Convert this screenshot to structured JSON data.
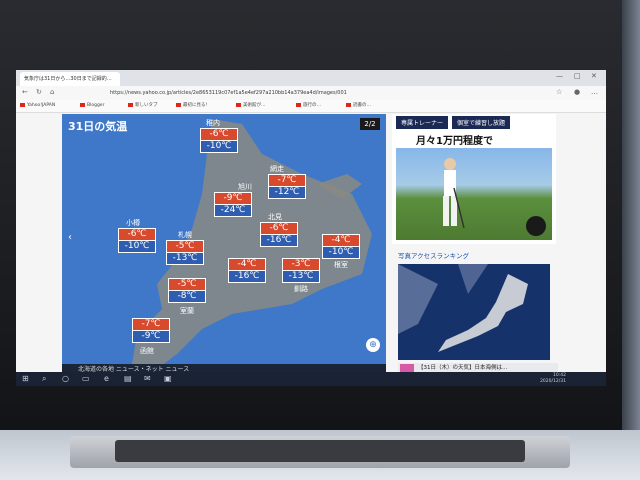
{
  "browser": {
    "tab_title": "気象庁は31日から…30日まで記録的…",
    "url": "https://news.yahoo.co.jp/articles/2e8653119c07ef1a5e4ef297a210bb14a379ea4d/images/001",
    "bookmarks": [
      "Yahoo!JAPAN",
      "Blogger",
      "新しいタブ",
      "最初に見る!",
      "美術館が…",
      "旅行の…",
      "読書の…"
    ]
  },
  "map": {
    "title": "31日の気温",
    "page_indicator": "2/2",
    "prev_arrow": "‹",
    "zoom_icon": "⊕",
    "caption": "北海道の各地 ニュース・ネット ニュース",
    "cities": [
      {
        "name": "稚内",
        "hi": "-6℃",
        "lo": "-10℃"
      },
      {
        "name": "網走",
        "hi": "-7℃",
        "lo": "-12℃"
      },
      {
        "name": "旭川",
        "hi": "-9℃",
        "lo": "-24℃"
      },
      {
        "name": "北見",
        "hi": "-6℃",
        "lo": "-16℃"
      },
      {
        "name": "小樽",
        "hi": "-6℃",
        "lo": "-10℃"
      },
      {
        "name": "札幌",
        "hi": "-5℃",
        "lo": "-13℃"
      },
      {
        "name": "帯広",
        "hi": "-4℃",
        "lo": "-16℃"
      },
      {
        "name": "釧路",
        "hi": "-3℃",
        "lo": "-13℃"
      },
      {
        "name": "根室",
        "hi": "-4℃",
        "lo": "-10℃"
      },
      {
        "name": "室蘭",
        "hi": "-5℃",
        "lo": "-8℃"
      },
      {
        "name": "函館",
        "hi": "-7℃",
        "lo": "-9℃"
      }
    ]
  },
  "ad": {
    "label1": "専属トレーナー",
    "label2": "個室で練習し放題",
    "price": "月々1万円程度で"
  },
  "sidebar": {
    "ranking_title": "写真アクセスランキング",
    "news_item": "【31日（木）の天気】日本海側は…"
  },
  "taskbar": {
    "time": "10:42",
    "date": "2020/12/31"
  }
}
